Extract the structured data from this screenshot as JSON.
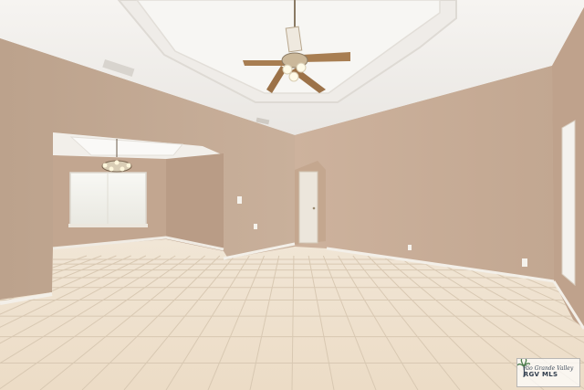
{
  "photo": {
    "subject": "empty-room-interior",
    "colors": {
      "wall": "#c8ad97",
      "wall_shadow": "#b89c86",
      "ceiling": "#f4f2ef",
      "floor_tile": "#efe4d4",
      "grout": "#d9cab6",
      "baseboard": "#f3efe8",
      "door": "#ece6dc"
    }
  },
  "watermark": {
    "line1": "Rio Grande Valley",
    "line2": "RGV MLS",
    "icon": "palm-tree-icon"
  }
}
